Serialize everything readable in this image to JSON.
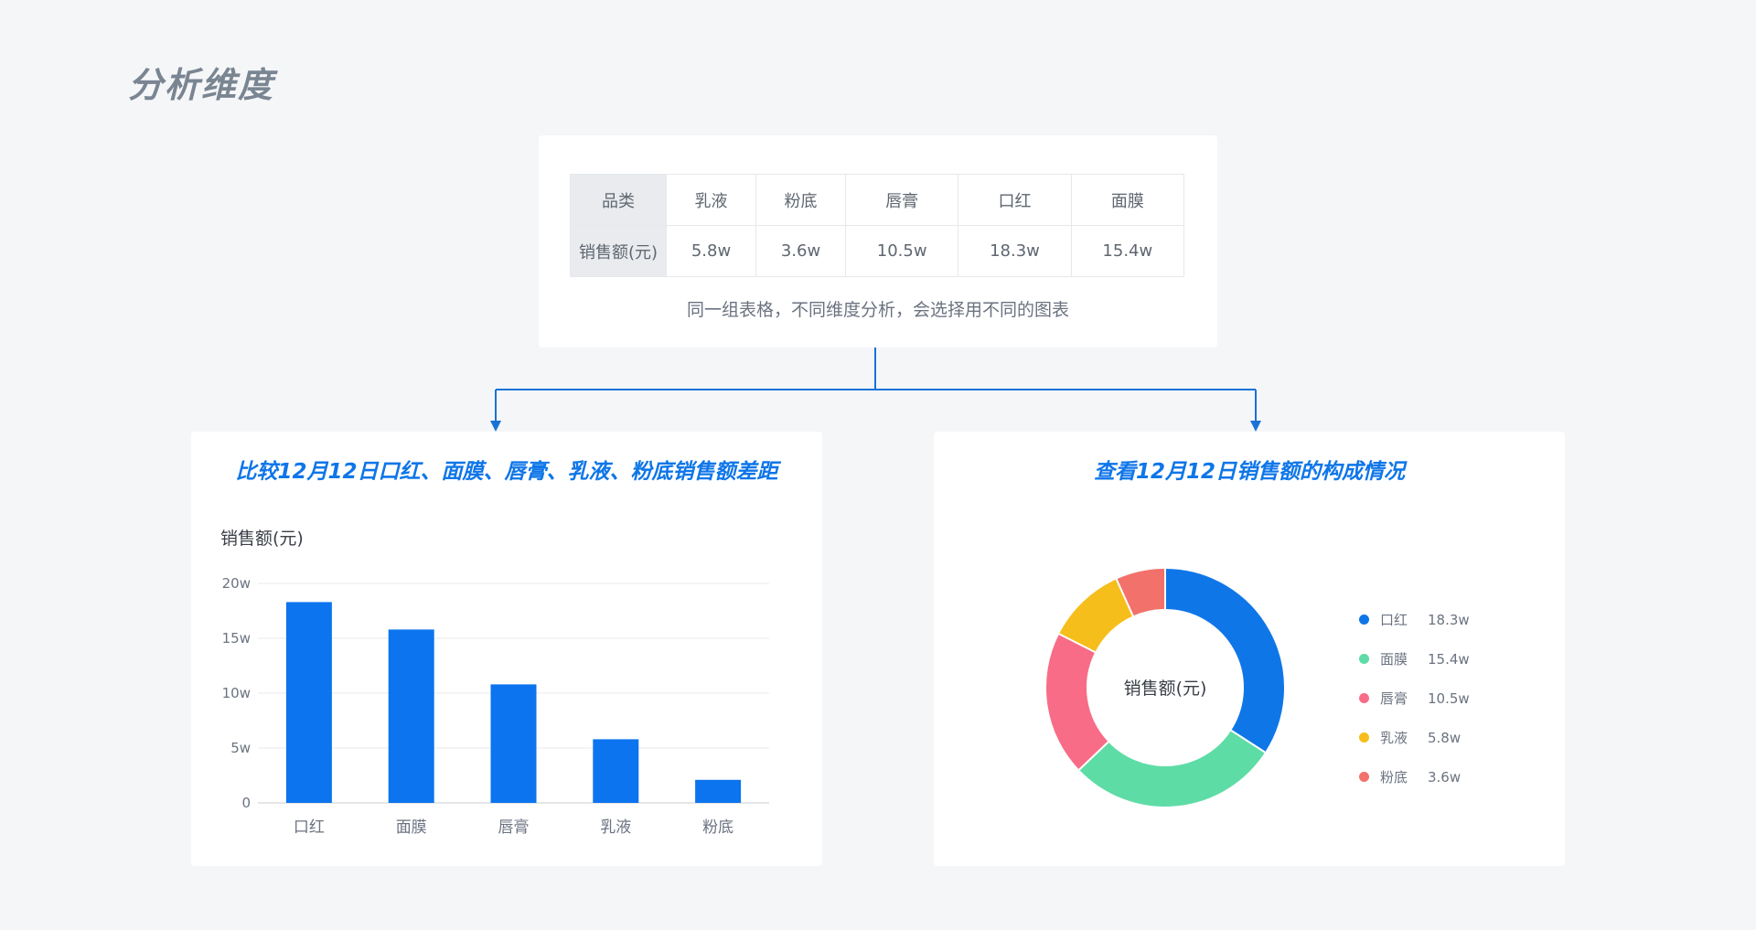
{
  "page": {
    "title": "分析维度"
  },
  "table": {
    "header_label": "品类",
    "row_label": "销售额(元)",
    "categories": [
      "乳液",
      "粉底",
      "唇膏",
      "口红",
      "面膜"
    ],
    "values": [
      "5.8w",
      "3.6w",
      "10.5w",
      "18.3w",
      "15.4w"
    ],
    "caption": "同一组表格，不同维度分析，会选择用不同的图表"
  },
  "colors": {
    "accent": "#0f76e8",
    "bar": "#0c74ee",
    "connector": "#1a72d6"
  },
  "chart_data": [
    {
      "type": "bar",
      "title": "比较12月12日口红、面膜、唇膏、乳液、粉底销售额差距",
      "ylabel": "销售额(元)",
      "xlabel": "",
      "categories": [
        "口红",
        "面膜",
        "唇膏",
        "乳液",
        "粉底"
      ],
      "values": [
        18.3,
        15.8,
        10.8,
        5.8,
        2.1
      ],
      "ylim": [
        0,
        20
      ],
      "yticks": [
        "0",
        "5w",
        "10w",
        "15w",
        "20w"
      ],
      "grid": true
    },
    {
      "type": "pie",
      "title": "查看12月12日销售额的构成情况",
      "center_label": "销售额(元)",
      "slices": [
        {
          "label": "口红",
          "value": 18.3,
          "display": "18.3w",
          "color": "#0f76e8"
        },
        {
          "label": "面膜",
          "value": 15.4,
          "display": "15.4w",
          "color": "#5edca6"
        },
        {
          "label": "唇膏",
          "value": 10.5,
          "display": "10.5w",
          "color": "#f86c87"
        },
        {
          "label": "乳液",
          "value": 5.8,
          "display": "5.8w",
          "color": "#f6be1a"
        },
        {
          "label": "粉底",
          "value": 3.6,
          "display": "3.6w",
          "color": "#f2716a"
        }
      ]
    }
  ]
}
